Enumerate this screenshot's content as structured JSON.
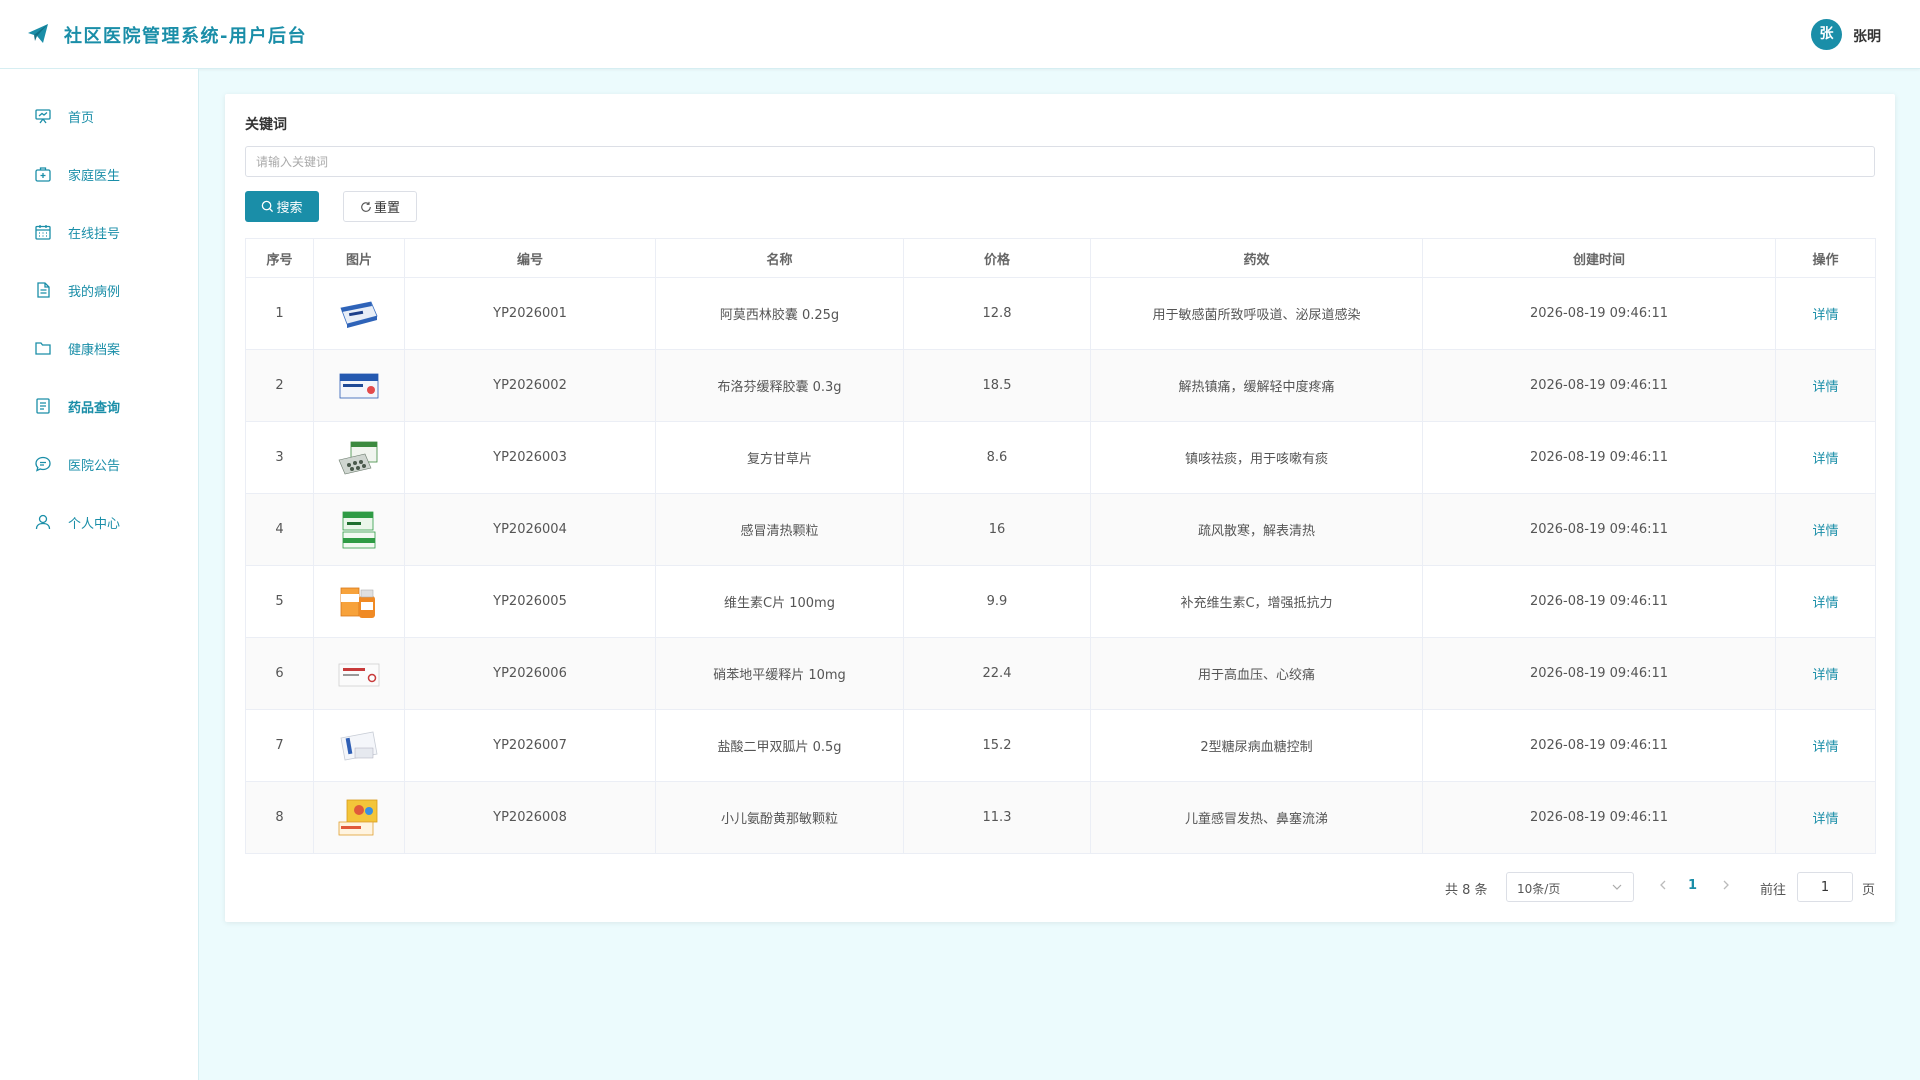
{
  "header": {
    "title": "社区医院管理系统-用户后台",
    "user_avatar_text": "张",
    "user_name": "张明",
    "accent_color": "#1a8ea8"
  },
  "sidebar": {
    "items": [
      {
        "label": "首页",
        "icon": "presentation-board-icon"
      },
      {
        "label": "家庭医生",
        "icon": "medical-kit-icon"
      },
      {
        "label": "在线挂号",
        "icon": "calendar-icon"
      },
      {
        "label": "我的病例",
        "icon": "document-icon"
      },
      {
        "label": "健康档案",
        "icon": "folder-icon"
      },
      {
        "label": "药品查询",
        "icon": "list-document-icon",
        "active": true
      },
      {
        "label": "医院公告",
        "icon": "chat-bubble-icon"
      },
      {
        "label": "个人中心",
        "icon": "user-icon"
      }
    ]
  },
  "search": {
    "label": "关键词",
    "placeholder": "请输入关键词",
    "value": "",
    "search_label": "搜索",
    "reset_label": "重置"
  },
  "table": {
    "headers": [
      "序号",
      "图片",
      "编号",
      "名称",
      "价格",
      "药效",
      "创建时间",
      "操作"
    ],
    "action_label": "详情",
    "rows": [
      {
        "index": "1",
        "code": "YP2026001",
        "name": "阿莫西林胶囊 0.25g",
        "price": "12.8",
        "effect": "用于敏感菌所致呼吸道、泌尿道感染",
        "created": "2026-08-19 09:46:11",
        "thumb": "blue-box"
      },
      {
        "index": "2",
        "code": "YP2026002",
        "name": "布洛芬缓释胶囊 0.3g",
        "price": "18.5",
        "effect": "解热镇痛，缓解轻中度疼痛",
        "created": "2026-08-19 09:46:11",
        "thumb": "blue-box"
      },
      {
        "index": "3",
        "code": "YP2026003",
        "name": "复方甘草片",
        "price": "8.6",
        "effect": "镇咳祛痰，用于咳嗽有痰",
        "created": "2026-08-19 09:46:11",
        "thumb": "green-blister"
      },
      {
        "index": "4",
        "code": "YP2026004",
        "name": "感冒清热颗粒",
        "price": "16",
        "effect": "疏风散寒，解表清热",
        "created": "2026-08-19 09:46:11",
        "thumb": "green-box"
      },
      {
        "index": "5",
        "code": "YP2026005",
        "name": "维生素C片 100mg",
        "price": "9.9",
        "effect": "补充维生素C，增强抵抗力",
        "created": "2026-08-19 09:46:11",
        "thumb": "orange-bottle"
      },
      {
        "index": "6",
        "code": "YP2026006",
        "name": "硝苯地平缓释片 10mg",
        "price": "22.4",
        "effect": "用于高血压、心绞痛",
        "created": "2026-08-19 09:46:11",
        "thumb": "white-red-box"
      },
      {
        "index": "7",
        "code": "YP2026007",
        "name": "盐酸二甲双胍片 0.5g",
        "price": "15.2",
        "effect": "2型糖尿病血糖控制",
        "created": "2026-08-19 09:46:11",
        "thumb": "white-blister"
      },
      {
        "index": "8",
        "code": "YP2026008",
        "name": "小儿氨酚黄那敏颗粒",
        "price": "11.3",
        "effect": "儿童感冒发热、鼻塞流涕",
        "created": "2026-08-19 09:46:11",
        "thumb": "kids-box"
      }
    ]
  },
  "pagination": {
    "total_text": "共 8 条",
    "page_size": "10条/页",
    "current_page": "1",
    "goto_label": "前往",
    "jump_value": "1",
    "page_label": "页"
  }
}
